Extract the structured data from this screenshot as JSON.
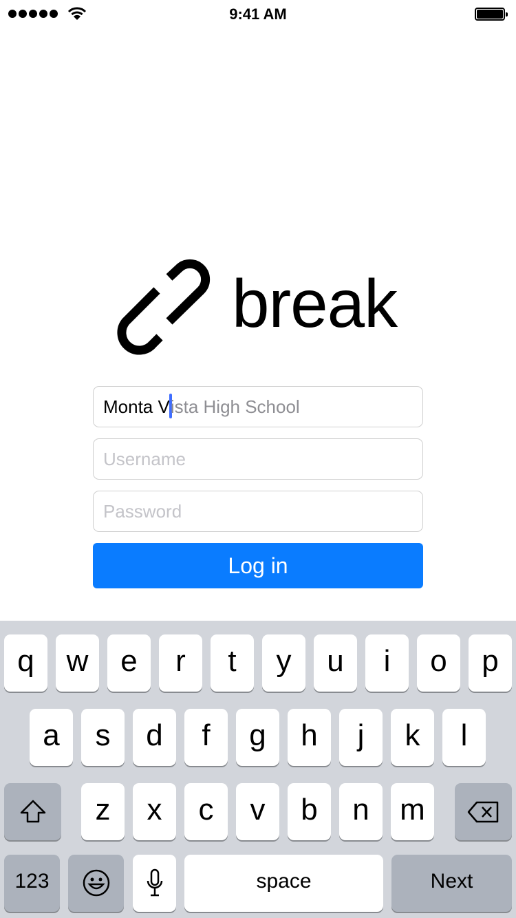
{
  "status_bar": {
    "time": "9:41 AM",
    "signal_bars": 5,
    "battery_level": 1.0
  },
  "brand": {
    "name": "break",
    "icon": "broken-link-icon"
  },
  "form": {
    "school": {
      "typed": "Monta V",
      "suggestion": "ista High School"
    },
    "username": {
      "placeholder": "Username",
      "value": ""
    },
    "password": {
      "placeholder": "Password",
      "value": ""
    },
    "login_label": "Log in",
    "accent": "#0a7cff"
  },
  "keyboard": {
    "row1": [
      "q",
      "w",
      "e",
      "r",
      "t",
      "y",
      "u",
      "i",
      "o",
      "p"
    ],
    "row2": [
      "a",
      "s",
      "d",
      "f",
      "g",
      "h",
      "j",
      "k",
      "l"
    ],
    "row3": [
      "z",
      "x",
      "c",
      "v",
      "b",
      "n",
      "m"
    ],
    "numbers_label": "123",
    "space_label": "space",
    "next_label": "Next"
  }
}
